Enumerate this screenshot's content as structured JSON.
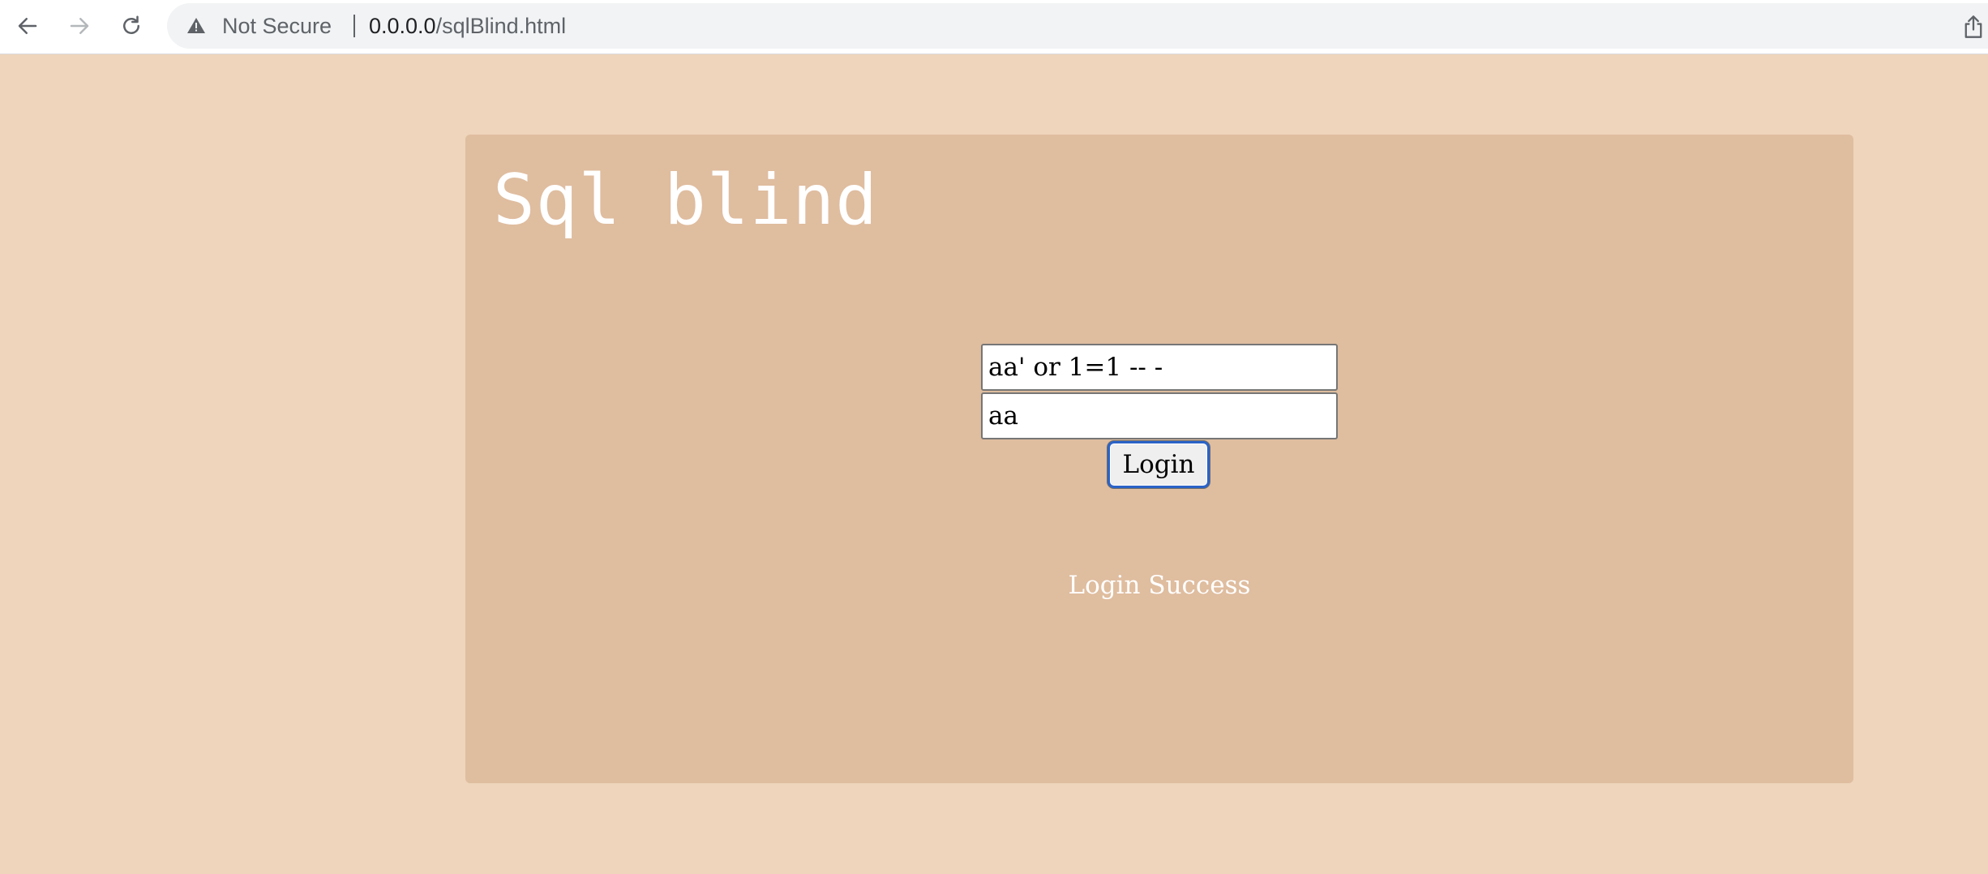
{
  "browser": {
    "security_label": "Not Secure",
    "url_host": "0.0.0.0",
    "url_path": "/sqlBlind.html"
  },
  "page": {
    "title": "Sql blind",
    "username_value": "aa' or 1=1 -- -",
    "password_value": "aa",
    "login_label": "Login",
    "status_message": "Login Success"
  },
  "icons": {
    "back": "arrow-left-icon",
    "forward": "arrow-right-icon",
    "reload": "reload-icon",
    "security": "warning-triangle-icon",
    "share": "share-icon"
  },
  "colors": {
    "page_background": "#eed5bb",
    "panel_background": "#dfbd9f",
    "text_light": "#ffffff",
    "focus_ring": "#2b63c7"
  }
}
